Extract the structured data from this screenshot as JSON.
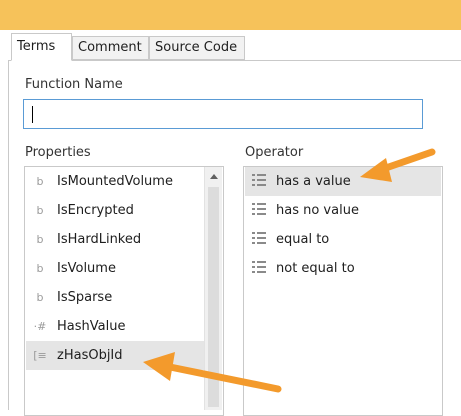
{
  "tabs": [
    {
      "label": "Terms",
      "active": true
    },
    {
      "label": "Comment",
      "active": false
    },
    {
      "label": "Source Code",
      "active": false
    }
  ],
  "function_name": {
    "label": "Function Name",
    "value": ""
  },
  "properties": {
    "label": "Properties",
    "items": [
      {
        "icon": "boolean-icon",
        "glyph": "b",
        "label": "IsMountedVolume",
        "selected": false
      },
      {
        "icon": "boolean-icon",
        "glyph": "b",
        "label": "IsEncrypted",
        "selected": false
      },
      {
        "icon": "boolean-icon",
        "glyph": "b",
        "label": "IsHardLinked",
        "selected": false
      },
      {
        "icon": "boolean-icon",
        "glyph": "b",
        "label": "IsVolume",
        "selected": false
      },
      {
        "icon": "boolean-icon",
        "glyph": "b",
        "label": "IsSparse",
        "selected": false
      },
      {
        "icon": "hash-icon",
        "glyph": "·#",
        "label": "HashValue",
        "selected": false
      },
      {
        "icon": "bracket-list-icon",
        "glyph": "[≡",
        "label": "zHasObjId",
        "selected": true
      }
    ]
  },
  "operator": {
    "label": "Operator",
    "items": [
      {
        "icon": "operator-list-icon",
        "label": "has a value",
        "selected": true
      },
      {
        "icon": "operator-list-icon",
        "label": "has no value",
        "selected": false
      },
      {
        "icon": "operator-list-icon",
        "label": "equal to",
        "selected": false
      },
      {
        "icon": "operator-list-icon",
        "label": "not equal to",
        "selected": false
      }
    ]
  },
  "colors": {
    "titlebar": "#f6c25a",
    "arrow": "#f39a2c",
    "input_focus_border": "#5a9bd5",
    "selection": "#e5e5e5"
  }
}
